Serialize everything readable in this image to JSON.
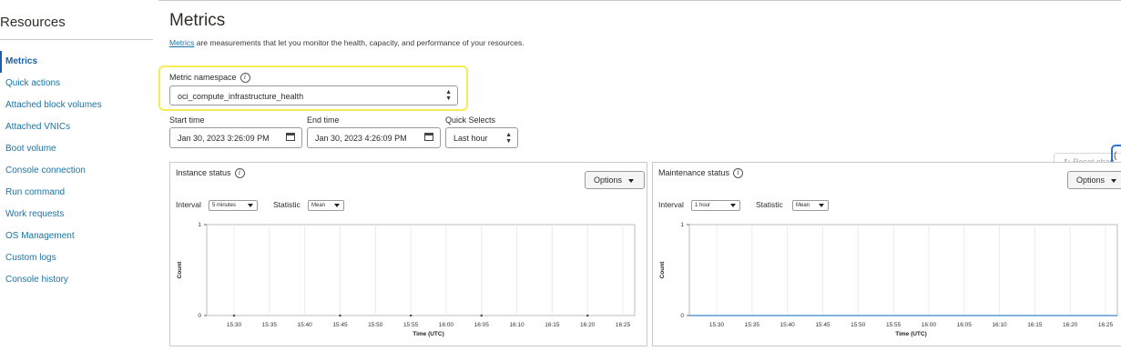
{
  "sidebar": {
    "title": "Resources",
    "items": [
      {
        "label": "Metrics",
        "active": true
      },
      {
        "label": "Quick actions"
      },
      {
        "label": "Attached block volumes"
      },
      {
        "label": "Attached VNICs"
      },
      {
        "label": "Boot volume"
      },
      {
        "label": "Console connection"
      },
      {
        "label": "Run command"
      },
      {
        "label": "Work requests"
      },
      {
        "label": "OS Management"
      },
      {
        "label": "Custom logs"
      },
      {
        "label": "Console history"
      }
    ]
  },
  "main": {
    "title": "Metrics",
    "description_link": "Metrics",
    "description_rest": " are measurements that let you monitor the health, capacity, and performance of your resources."
  },
  "namespace": {
    "label": "Metric namespace",
    "value": "oci_compute_infrastructure_health"
  },
  "time": {
    "start_label": "Start time",
    "start_value": "Jan 30, 2023 3:26:09 PM",
    "end_label": "End time",
    "end_value": "Jan 30, 2023 4:26:09 PM",
    "quick_label": "Quick Selects",
    "quick_value": "Last hour"
  },
  "reset_label": "Reset chart",
  "panels": [
    {
      "title": "Instance status",
      "options_label": "Options",
      "interval_label": "Interval",
      "interval_value": "5 minutes",
      "statistic_label": "Statistic",
      "statistic_value": "Mean"
    },
    {
      "title": "Maintenance status",
      "options_label": "Options",
      "interval_label": "Interval",
      "interval_value": "1 hour",
      "statistic_label": "Statistic",
      "statistic_value": "Mean"
    }
  ],
  "chart_data": [
    {
      "type": "line",
      "title": "Instance status",
      "xlabel": "Time (UTC)",
      "ylabel": "Count",
      "x_ticks": [
        "15:30",
        "15:35",
        "15:40",
        "15:45",
        "15:50",
        "15:55",
        "16:00",
        "16:05",
        "16:10",
        "16:15",
        "16:20",
        "16:25"
      ],
      "y_ticks": [
        0,
        1
      ],
      "ylim": [
        0,
        1
      ],
      "grid": true,
      "series": [
        {
          "x": [
            "15:30",
            "15:45",
            "15:55",
            "16:05",
            "16:20"
          ],
          "values": [
            0,
            0,
            0,
            0,
            0
          ]
        }
      ]
    },
    {
      "type": "line",
      "title": "Maintenance status",
      "xlabel": "Time (UTC)",
      "ylabel": "Count",
      "x_ticks": [
        "15:30",
        "15:35",
        "15:40",
        "15:45",
        "15:50",
        "15:55",
        "16:00",
        "16:05",
        "16:10",
        "16:15",
        "16:20",
        "16:25"
      ],
      "y_ticks": [
        0,
        1
      ],
      "ylim": [
        0,
        1
      ],
      "grid": true,
      "series": [
        {
          "x": [
            "15:25",
            "16:28"
          ],
          "values": [
            0,
            0
          ]
        }
      ]
    }
  ]
}
